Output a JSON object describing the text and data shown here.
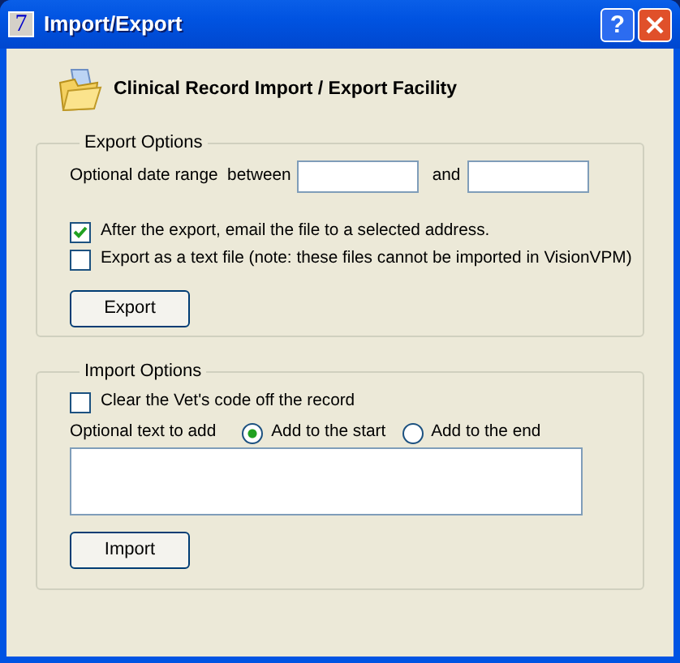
{
  "window": {
    "title": "Import/Export",
    "app_icon_glyph": "7",
    "help_glyph": "?"
  },
  "header": {
    "title": "Clinical Record Import / Export Facility"
  },
  "export_options": {
    "legend": "Export Options",
    "date_range_label": "Optional date range  between",
    "and_label": "and",
    "checkboxes": [
      {
        "label": "After the export, email the file to a selected address.",
        "checked": true
      },
      {
        "label": "Export as a text file (note: these files cannot be imported in VisionVPM)",
        "checked": false
      }
    ],
    "button": "Export"
  },
  "import_options": {
    "legend": "Import Options",
    "checkboxes": [
      {
        "label": "Clear the Vet's code off the record",
        "checked": false
      }
    ],
    "text_label": "Optional text to add",
    "radios": [
      {
        "label": "Add to the start",
        "selected": true
      },
      {
        "label": "Add to the end",
        "selected": false
      }
    ],
    "button": "Import"
  }
}
